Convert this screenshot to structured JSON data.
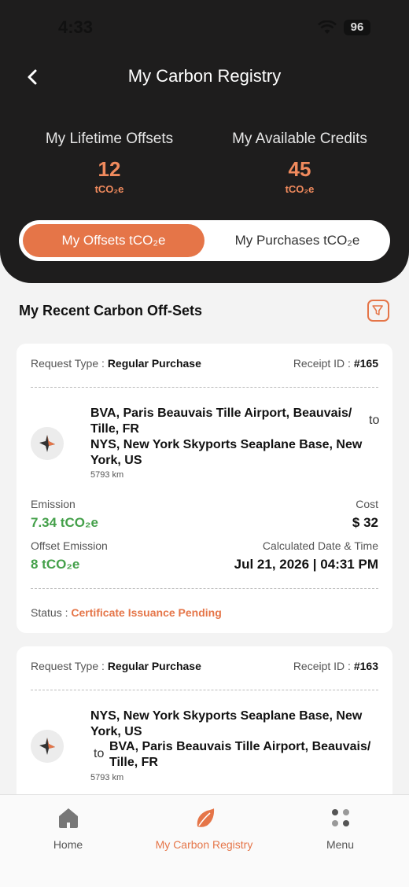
{
  "status_bar": {
    "time": "4:33",
    "battery": "96"
  },
  "header": {
    "title": "My Carbon Registry",
    "back_icon": "chevron-left-icon"
  },
  "stats": [
    {
      "label": "My Lifetime Offsets",
      "value": "12",
      "unit": "tCO₂e"
    },
    {
      "label": "My Available Credits",
      "value": "45",
      "unit": "tCO₂e"
    }
  ],
  "toggle": {
    "active": "My Offsets tCO₂e",
    "inactive": "My Purchases tCO₂e"
  },
  "section": {
    "title": "My Recent Carbon Off-Sets",
    "filter_icon": "filter-icon"
  },
  "cards": [
    {
      "request_label": "Request Type :",
      "request_type": "Regular Purchase",
      "receipt_label": "Receipt ID  :",
      "receipt_id": "#165",
      "from": "BVA, Paris Beauvais Tille Airport, Beauvais/ Tille, FR",
      "to_word": "to",
      "to": "NYS, New York Skyports Seaplane Base, New York, US",
      "distance": "5793 km",
      "emission_label": "Emission",
      "emission": "7.34 tCO₂e",
      "cost_label": "Cost",
      "cost": "$ 32",
      "offset_label": "Offset Emission",
      "offset": "8 tCO₂e",
      "date_label": "Calculated Date & Time",
      "date": "Jul 21, 2026 | 04:31 PM",
      "status_label": "Status :",
      "status": "Certificate Issuance Pending"
    },
    {
      "request_label": "Request Type :",
      "request_type": "Regular Purchase",
      "receipt_label": "Receipt ID  :",
      "receipt_id": "#163",
      "from": "NYS, New York Skyports Seaplane Base, New York, US",
      "to_word": "to",
      "to": "BVA, Paris Beauvais Tille Airport, Beauvais/ Tille, FR",
      "distance": "5793 km"
    }
  ],
  "nav": [
    {
      "label": "Home",
      "icon": "home-icon"
    },
    {
      "label": "My Carbon Registry",
      "icon": "leaf-icon"
    },
    {
      "label": "Menu",
      "icon": "menu-dots-icon"
    }
  ],
  "colors": {
    "accent": "#e57548",
    "green": "#44a04a",
    "dark": "#1e1d1d"
  }
}
